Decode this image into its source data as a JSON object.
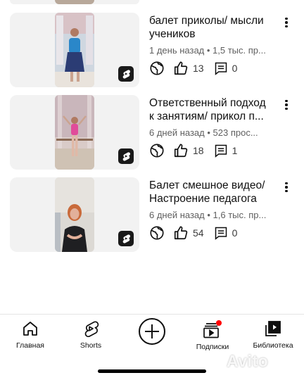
{
  "colors": {
    "accent_red": "#ff0000",
    "text_primary": "#0f0f0f",
    "text_secondary": "#606060"
  },
  "videos": [
    {
      "title_line1": "балет приколы/ мысли",
      "title_line2": "учеников",
      "subline": "1 день назад • 1,5 тыс. пр...",
      "likes": "13",
      "comments": "0",
      "icons": [
        "globe-icon",
        "thumbs-up-icon",
        "comment-icon",
        "more-vert-icon",
        "shorts-icon"
      ]
    },
    {
      "title_line1": "Ответственный подход",
      "title_line2": "к занятиям/ прикол п...",
      "subline": "6 дней назад • 523 прос...",
      "likes": "18",
      "comments": "1",
      "icons": [
        "globe-icon",
        "thumbs-up-icon",
        "comment-icon",
        "more-vert-icon",
        "shorts-icon"
      ]
    },
    {
      "title_line1": "Балет смешное видео/",
      "title_line2": "Настроение педагога",
      "subline": "6 дней назад • 1,6 тыс. пр...",
      "likes": "54",
      "comments": "0",
      "icons": [
        "globe-icon",
        "thumbs-up-icon",
        "comment-icon",
        "more-vert-icon",
        "shorts-icon"
      ]
    }
  ],
  "nav": {
    "home": "Главная",
    "shorts": "Shorts",
    "create": "",
    "subscriptions": "Подписки",
    "library": "Библиотека",
    "icons": [
      "home-icon",
      "shorts-icon",
      "add-circle-icon",
      "subscriptions-icon",
      "library-icon"
    ]
  },
  "watermark": "Avito"
}
